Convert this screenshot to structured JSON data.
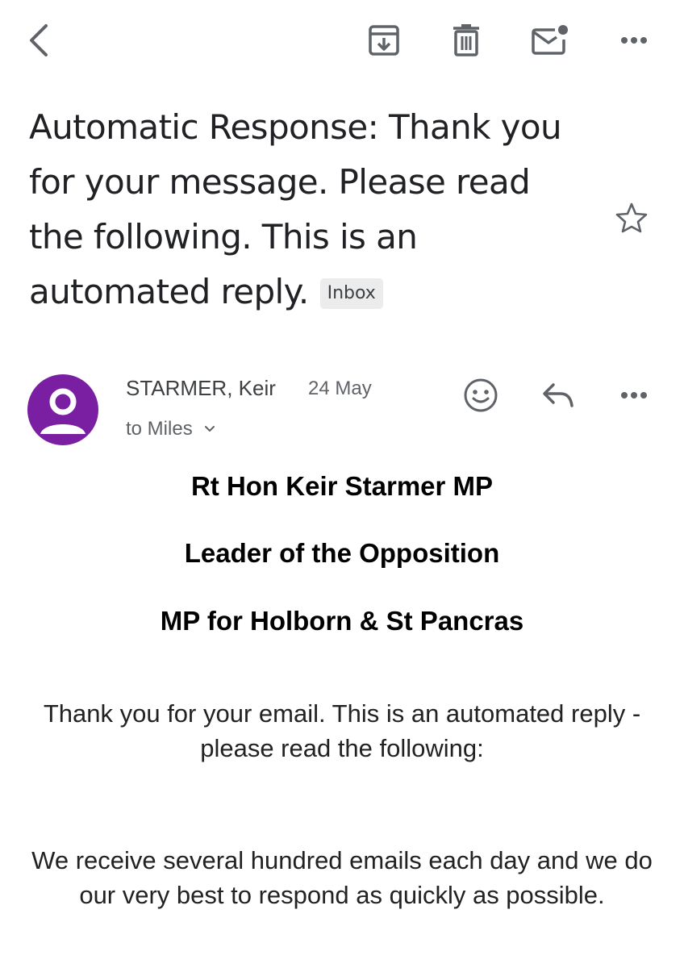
{
  "toolbar": {
    "back_icon": "chevron-left-icon",
    "archive_icon": "archive-icon",
    "delete_icon": "trash-icon",
    "mark_unread_icon": "mark-unread-icon",
    "more_icon": "more-horizontal-icon"
  },
  "email": {
    "subject": "Automatic Response: Thank you for your message.  Please read the following.  This is an automated reply.",
    "label": "Inbox",
    "starred": false
  },
  "message": {
    "sender": "STARMER, Keir",
    "date": "24 May",
    "recipient_line": "to Miles",
    "avatar_color": "#7b1fa2",
    "body": {
      "heading1": "Rt Hon Keir Starmer MP",
      "heading2": "Leader of the Opposition",
      "heading3": "MP for Holborn & St Pancras",
      "para1": "Thank you for your email. This is an automated reply - please read the following:",
      "para2": "We receive several hundred emails each day and we do our very best to respond as quickly as possible."
    }
  }
}
